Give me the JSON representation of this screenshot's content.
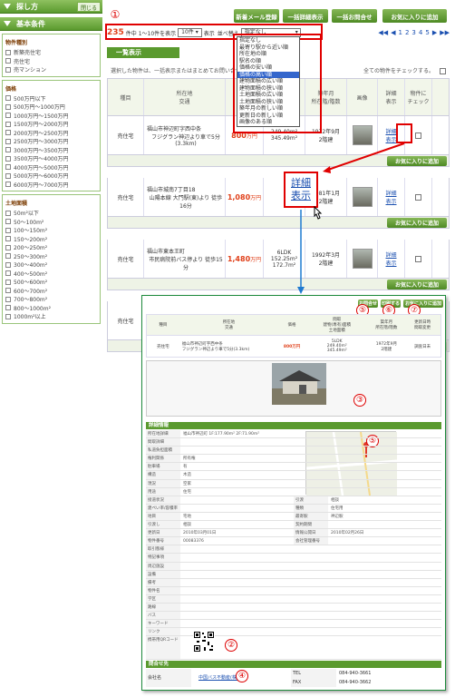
{
  "sidebar": {
    "close_label": "閉じる",
    "sections": [
      {
        "label": "探し方"
      },
      {
        "label": "基本条件"
      }
    ],
    "groups": [
      {
        "title": "物件種別",
        "items": [
          "新築売住宅",
          "売住宅",
          "売マンション"
        ]
      },
      {
        "title": "価格",
        "items": [
          "500万円以下",
          "500万円〜1000万円",
          "1000万円〜1500万円",
          "1500万円〜2000万円",
          "2000万円〜2500万円",
          "2500万円〜3000万円",
          "3000万円〜3500万円",
          "3500万円〜4000万円",
          "4000万円〜5000万円",
          "5000万円〜6000万円",
          "6000万円〜7000万円"
        ]
      },
      {
        "title": "土地面積",
        "items": [
          "50m²以下",
          "50〜100m²",
          "100〜150m²",
          "150〜200m²",
          "200〜250m²",
          "250〜300m²",
          "300〜400m²",
          "400〜500m²",
          "500〜600m²",
          "600〜700m²",
          "700〜800m²",
          "800〜1000m²",
          "1000m²以上"
        ]
      }
    ]
  },
  "toolbar": {
    "buttons": [
      "新着メール登録",
      "一括詳細表示",
      "一括お問合せ",
      "お気に入りに追加"
    ]
  },
  "pager": {
    "count": "235",
    "count_text": "件中 1〜10件を表示",
    "per_page": "10件",
    "display_label": "表示",
    "sort_label": "並べ替え",
    "sort_value": "指定なし",
    "pages": [
      "◀◀",
      "◀",
      "1",
      "2",
      "3",
      "4",
      "5",
      "▶",
      "▶▶"
    ]
  },
  "sort_options": [
    "指定なし",
    "最寄り駅から近い順",
    "所在地の順",
    "駅名の順",
    "価格の安い順",
    "価格の高い順",
    "建物面積の広い順",
    "建物面積の狭い順",
    "土地面積の広い順",
    "土地面積の狭い順",
    "築年月の新しい順",
    "更新日の新しい順",
    "画像のある順"
  ],
  "sort_selected_index": 5,
  "callouts": [
    "①",
    "②",
    "③",
    "④",
    "⑤",
    "⑥",
    "⑦"
  ],
  "listing": {
    "header": "一覧表示",
    "note": "選択した物件は、一括表示またはまとめてお問い合せ",
    "check_all": "全ての物件をチェックする。",
    "columns": [
      "種目",
      "所在地\n交通",
      "価格",
      "土地面積\n建物面積",
      "築年月\n所在階/階数",
      "画像",
      "詳細\n表示",
      "物件に\nチェック"
    ],
    "add_fav": "お気に入りに追加",
    "rows": [
      {
        "type": "売住宅",
        "addr": "福山市神辺町字西中条",
        "access": "フジグラン神辺より車で5分(3.3km)",
        "price": "800",
        "unit": "万円",
        "area": "249.40m²\n345.49m²",
        "built": "1972年9月\n2階建",
        "detail": "詳細\n表示"
      },
      {
        "type": "売住宅",
        "addr": "福山市城南7丁目18",
        "access": "山陽本線 大門駅(東)より 徒歩16分",
        "price": "1,080",
        "unit": "万円",
        "area": "",
        "built": "1981年1月\n2階建",
        "detail": "詳細\n表示"
      },
      {
        "type": "売住宅",
        "addr": "福山市東本王町",
        "access": "市民病院前バス停より 徒歩15分",
        "price": "1,480",
        "unit": "万円",
        "area": "6LDK\n152.25m²\n172.7m²",
        "built": "1992年3月\n2階建",
        "detail": "詳細\n表示"
      },
      {
        "type": "売住宅",
        "addr": "福山市緑町2丁目",
        "access": "緑町南口バス停より 徒歩4分",
        "price": "890",
        "unit": "万円",
        "area": "4DK\n92.56m²\n97.46m²",
        "built": "1977年9月\n2階建",
        "detail": "詳細\n表示"
      }
    ]
  },
  "big_detail": "詳細\n表示",
  "detail": {
    "buttons": [
      "お問合せ",
      "印刷する",
      "お気に入りに追加"
    ],
    "head_cols": [
      "種目",
      "所在地\n交通",
      "価格",
      "間取\n建物(専有)面積\n土地面積",
      "築年月\n所在階/階数",
      "更新日時\n間取変更"
    ],
    "head_row": {
      "type": "売住宅",
      "addr": "福山市神辺町字西中条\nフジグラン神辺より車で5分(3.3km)",
      "price": "800万円",
      "area": "5LDK\n249.40m²\n345.49m²",
      "built": "1972年9月\n2階建",
      "updated": "調査日未"
    },
    "section1": "詳細情報",
    "fields_left": [
      "所在地詳細",
      "間取詳細",
      "私道負担面積",
      "権利関係",
      "駐車場",
      "構造",
      "現況",
      "用途",
      "接道状況",
      "建ぺい率/容積率",
      "地目",
      "引渡し",
      "更新日",
      "物件番号",
      "取引態様",
      "特記事項",
      "周辺施設",
      "設備",
      "備考",
      "物件名",
      "学区",
      "路線",
      "バス",
      "キーワード",
      "リンク",
      "携帯用QRコード"
    ],
    "fields_right": [
      "引渡",
      "種類",
      "最寄駅",
      "契約期間",
      "情報公開日",
      "会社管理番号"
    ],
    "values_left": [
      "福山市神辺町 1F:177.90m² 2F:71.90m²",
      "",
      "",
      "所有権",
      "有",
      "木造",
      "空家",
      "住宅",
      "",
      "",
      "宅地",
      "相談",
      "2010年03月01日",
      "00083376",
      "",
      "",
      "",
      "",
      "",
      "",
      "",
      "",
      "",
      "",
      "",
      ""
    ],
    "values_right": [
      "相談",
      "住宅用",
      "神辺駅",
      "",
      "2010年02月26日",
      ""
    ],
    "section2": "問合せ先",
    "contact": {
      "company_label": "会社名",
      "company": "中国バス不動産(株)",
      "tel_label": "TEL",
      "tel": "084-940-3661",
      "fax_label": "FAX",
      "fax": "084-940-3662"
    }
  }
}
